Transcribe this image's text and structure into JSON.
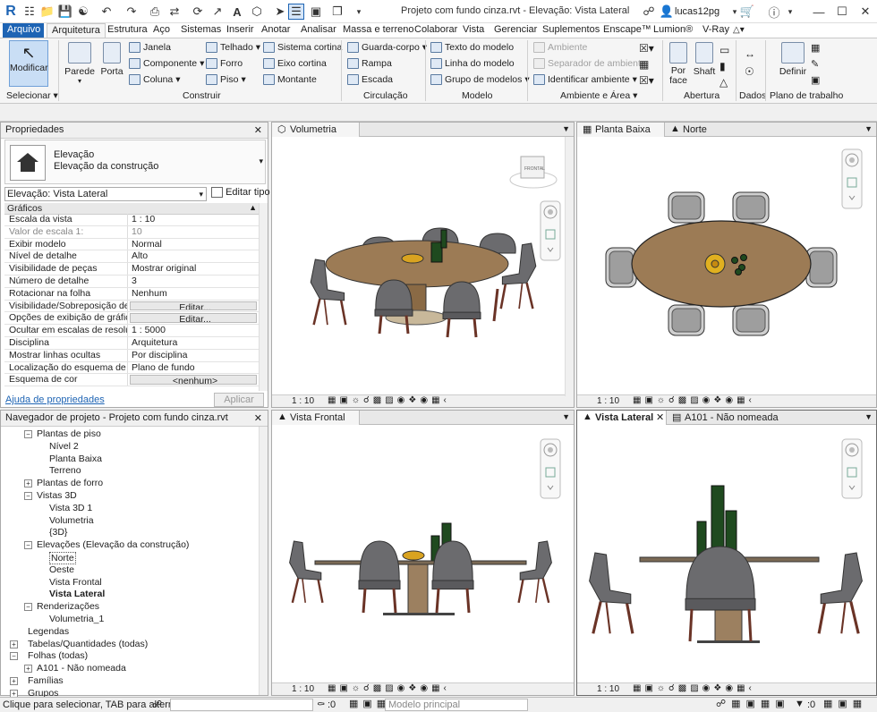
{
  "title": "Projeto com fundo cinza.rvt - Elevação: Vista Lateral",
  "user": "lucas12pg",
  "tabs": [
    "Arquivo",
    "Arquitetura",
    "Estrutura",
    "Aço",
    "Sistemas",
    "Inserir",
    "Anotar",
    "Analisar",
    "Massa e terreno",
    "Colaborar",
    "Vista",
    "Gerenciar",
    "Suplementos",
    "Enscape™",
    "Lumion®",
    "V-Ray"
  ],
  "ribbon": {
    "modify": "Modificar",
    "select": "Selecionar",
    "wall": "Parede",
    "door": "Porta",
    "window": "Janela",
    "component": "Componente",
    "column": "Coluna",
    "roof": "Telhado",
    "ceiling": "Forro",
    "floor": "Piso",
    "curtain_system": "Sistema cortina",
    "curtain_grid": "Eixo cortina",
    "mullion": "Montante",
    "railing": "Guarda-corpo",
    "ramp": "Rampa",
    "stair": "Escada",
    "model_text": "Texto do modelo",
    "model_line": "Linha do modelo",
    "model_group": "Grupo de modelos",
    "room": "Ambiente",
    "room_sep": "Separador de ambiente",
    "tag_room": "Identificar ambiente",
    "by_face": "Por face",
    "shaft": "Shaft",
    "set": "Definir",
    "panels": {
      "build": "Construir",
      "circulation": "Circulação",
      "model": "Modelo",
      "room_area": "Ambiente e Área",
      "opening": "Abertura",
      "datum": "Dados",
      "work_plane": "Plano de trabalho"
    }
  },
  "properties": {
    "title": "Propriedades",
    "type_line1": "Elevação",
    "type_line2": "Elevação da construção",
    "selector": "Elevação: Vista Lateral",
    "edit_type": "Editar tipo",
    "group": "Gráficos",
    "rows": [
      [
        "Escala da vista",
        "1 : 10"
      ],
      [
        "Valor de escala    1:",
        "10"
      ],
      [
        "Exibir modelo",
        "Normal"
      ],
      [
        "Nível de detalhe",
        "Alto"
      ],
      [
        "Visibilidade de peças",
        "Mostrar original"
      ],
      [
        "Número de detalhe",
        "3"
      ],
      [
        "Rotacionar na folha",
        "Nenhum"
      ],
      [
        "Visibilidade/Sobreposição de ...",
        "Editar..."
      ],
      [
        "Opções de exibição de gráficos",
        "Editar..."
      ],
      [
        "Ocultar em escalas de resoluç...",
        "1 : 5000"
      ],
      [
        "Disciplina",
        "Arquitetura"
      ],
      [
        "Mostrar linhas ocultas",
        "Por disciplina"
      ],
      [
        "Localização do esquema de cor",
        "Plano de fundo"
      ],
      [
        "Esquema de cor",
        "<nenhum>"
      ]
    ],
    "help": "Ajuda de propriedades",
    "apply": "Aplicar"
  },
  "browser": {
    "title": "Navegador de projeto - Projeto com fundo cinza.rvt",
    "items": [
      {
        "label": "Plantas de piso",
        "level": 1,
        "exp": "-"
      },
      {
        "label": "Nível 2",
        "level": 2
      },
      {
        "label": "Planta Baixa",
        "level": 2
      },
      {
        "label": "Terreno",
        "level": 2
      },
      {
        "label": "Plantas de forro",
        "level": 1,
        "exp": "+"
      },
      {
        "label": "Vistas 3D",
        "level": 1,
        "exp": "-"
      },
      {
        "label": "Vista 3D 1",
        "level": 2
      },
      {
        "label": "Volumetria",
        "level": 2
      },
      {
        "label": "{3D}",
        "level": 2
      },
      {
        "label": "Elevações (Elevação da construção)",
        "level": 1,
        "exp": "-"
      },
      {
        "label": "Norte",
        "level": 2,
        "sel": true
      },
      {
        "label": "Oeste",
        "level": 2
      },
      {
        "label": "Vista Frontal",
        "level": 2
      },
      {
        "label": "Vista Lateral",
        "level": 2,
        "bold": true
      },
      {
        "label": "Renderizações",
        "level": 1,
        "exp": "-"
      },
      {
        "label": "Volumetria_1",
        "level": 2
      },
      {
        "label": "Legendas",
        "level": 0,
        "exp": ""
      },
      {
        "label": "Tabelas/Quantidades (todas)",
        "level": 0,
        "exp": "+"
      },
      {
        "label": "Folhas (todas)",
        "level": 0,
        "exp": "-"
      },
      {
        "label": "A101 - Não nomeada",
        "level": 1,
        "exp": "+"
      },
      {
        "label": "Famílias",
        "level": 0,
        "exp": "+"
      },
      {
        "label": "Grupos",
        "level": 0,
        "exp": "+"
      }
    ]
  },
  "views": {
    "v1": {
      "tab": "Volumetria",
      "scale": "1 : 10"
    },
    "v2": {
      "tab": "Planta Baixa",
      "tab2": "Norte",
      "scale": "1 : 10"
    },
    "v3": {
      "tab": "Vista Frontal",
      "scale": "1 : 10"
    },
    "v4": {
      "tab": "Vista Lateral",
      "tab2": "A101 - Não nomeada",
      "scale": "1 : 10"
    }
  },
  "viewcube": "FRONTAL",
  "status": {
    "text": "Clique para selecionar, TAB para alternat",
    "count": ":0",
    "model": "Modelo principal",
    "filter": ":0"
  },
  "colors": {
    "accent": "#1e64b4",
    "table": "#9c7b55",
    "chair": "#6b6b6e",
    "leg": "#6a3326",
    "plant": "#1f4a1f"
  }
}
